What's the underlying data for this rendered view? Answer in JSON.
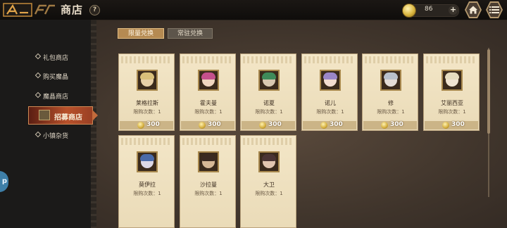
{
  "header": {
    "title": "商店",
    "help_label": "?",
    "currency_value": "86",
    "plus_label": "+"
  },
  "sidebar": {
    "items": [
      {
        "label": "礼包商店"
      },
      {
        "label": "购买魔晶"
      },
      {
        "label": "魔晶商店"
      },
      {
        "label": "招募商店"
      },
      {
        "label": "小镇杂货"
      }
    ],
    "side_tab_label": "p"
  },
  "tabs": {
    "limited": "限量兑换",
    "permanent": "常驻兑换"
  },
  "cards": [
    {
      "name": "莱格拉斯",
      "limit": "限购次数：1",
      "price": "300"
    },
    {
      "name": "霍夫曼",
      "limit": "限购次数：1",
      "price": "300"
    },
    {
      "name": "诺夏",
      "limit": "限购次数：1",
      "price": "300"
    },
    {
      "name": "诺儿",
      "limit": "限购次数：1",
      "price": "300"
    },
    {
      "name": "修",
      "limit": "限购次数：1",
      "price": "300"
    },
    {
      "name": "艾丽西亚",
      "limit": "限购次数：1",
      "price": "300"
    },
    {
      "name": "莫伊拉",
      "limit": "限购次数：1",
      "price": ""
    },
    {
      "name": "沙拉曼",
      "limit": "限购次数：1",
      "price": ""
    },
    {
      "name": "大卫",
      "limit": "限购次数：1",
      "price": ""
    }
  ],
  "colors": {
    "accent": "#b8512b",
    "card_bg": "#f0e3c2",
    "tab_active": "#b58a52"
  },
  "icons": {
    "currency": "gold-coin-icon",
    "home": "home-icon",
    "menu": "menu-list-icon"
  }
}
